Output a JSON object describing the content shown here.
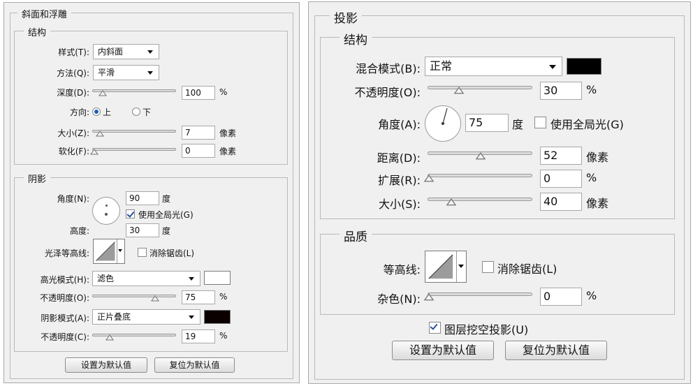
{
  "left_panel": {
    "title": "斜面和浮雕",
    "structure": {
      "title": "结构",
      "style_label": "样式(T):",
      "style_value": "内斜面",
      "technique_label": "方法(Q):",
      "technique_value": "平滑",
      "depth_label": "深度(D):",
      "depth_value": "100",
      "depth_unit": "%",
      "direction_label": "方向:",
      "direction_up": "上",
      "direction_down": "下",
      "direction_selected": "up",
      "size_label": "大小(Z):",
      "size_value": "7",
      "size_unit": "像素",
      "soften_label": "软化(F):",
      "soften_value": "0",
      "soften_unit": "像素"
    },
    "shading": {
      "title": "阴影",
      "angle_label": "角度(N):",
      "angle_value": "90",
      "angle_unit": "度",
      "global_light_label": "使用全局光(G)",
      "global_light_checked": true,
      "altitude_label": "高度:",
      "altitude_value": "30",
      "altitude_unit": "度",
      "gloss_contour_label": "光泽等高线:",
      "anti_alias_label": "消除锯齿(L)",
      "anti_alias_checked": false,
      "highlight_mode_label": "高光模式(H):",
      "highlight_mode_value": "滤色",
      "highlight_color": "#ffffff",
      "highlight_opacity_label": "不透明度(O):",
      "highlight_opacity_value": "75",
      "highlight_opacity_unit": "%",
      "shadow_mode_label": "阴影模式(A):",
      "shadow_mode_value": "正片叠底",
      "shadow_color": "#0a0000",
      "shadow_opacity_label": "不透明度(C):",
      "shadow_opacity_value": "19",
      "shadow_opacity_unit": "%"
    },
    "make_default_label": "设置为默认值",
    "reset_default_label": "复位为默认值"
  },
  "right_panel": {
    "title": "投影",
    "structure": {
      "title": "结构",
      "blend_mode_label": "混合模式(B):",
      "blend_mode_value": "正常",
      "color": "#000000",
      "opacity_label": "不透明度(O):",
      "opacity_value": "30",
      "opacity_unit": "%",
      "angle_label": "角度(A):",
      "angle_value": "75",
      "angle_unit": "度",
      "global_light_label": "使用全局光(G)",
      "global_light_checked": false,
      "distance_label": "距离(D):",
      "distance_value": "52",
      "distance_unit": "像素",
      "spread_label": "扩展(R):",
      "spread_value": "0",
      "spread_unit": "%",
      "size_label": "大小(S):",
      "size_value": "40",
      "size_unit": "像素"
    },
    "quality": {
      "title": "品质",
      "contour_label": "等高线:",
      "anti_alias_label": "消除锯齿(L)",
      "anti_alias_checked": false,
      "noise_label": "杂色(N):",
      "noise_value": "0",
      "noise_unit": "%"
    },
    "knockout_label": "图层挖空投影(U)",
    "knockout_checked": true,
    "make_default_label": "设置为默认值",
    "reset_default_label": "复位为默认值"
  }
}
